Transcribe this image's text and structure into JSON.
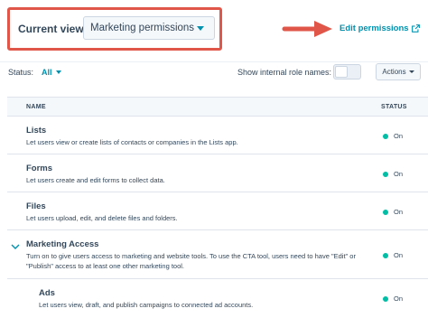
{
  "view": {
    "label": "Current view:",
    "selected": "Marketing permissions"
  },
  "edit_link": "Edit permissions",
  "filter": {
    "status_label": "Status:",
    "status_value": "All",
    "role_names_label": "Show internal role names:",
    "role_names_on": false,
    "actions_label": "Actions"
  },
  "table": {
    "headers": {
      "name": "NAME",
      "status": "STATUS"
    },
    "rows": [
      {
        "title": "Lists",
        "desc": "Let users view or create lists of contacts or companies in the Lists app.",
        "status": "On"
      },
      {
        "title": "Forms",
        "desc": "Let users create and edit forms to collect data.",
        "status": "On"
      },
      {
        "title": "Files",
        "desc": "Let users upload, edit, and delete files and folders.",
        "status": "On"
      },
      {
        "title": "Marketing Access",
        "desc": "Turn on to give users access to marketing and website tools. To use the CTA tool, users need to have \"Edit\" or \"Publish\" access to at least one other marketing tool.",
        "status": "On",
        "expanded": true
      },
      {
        "title": "Ads",
        "desc": "Let users view, draft, and publish campaigns to connected ad accounts.",
        "status": "On"
      }
    ]
  },
  "colors": {
    "accent": "#0091ae",
    "highlight": "#e0574a",
    "status_on": "#00bda5"
  }
}
